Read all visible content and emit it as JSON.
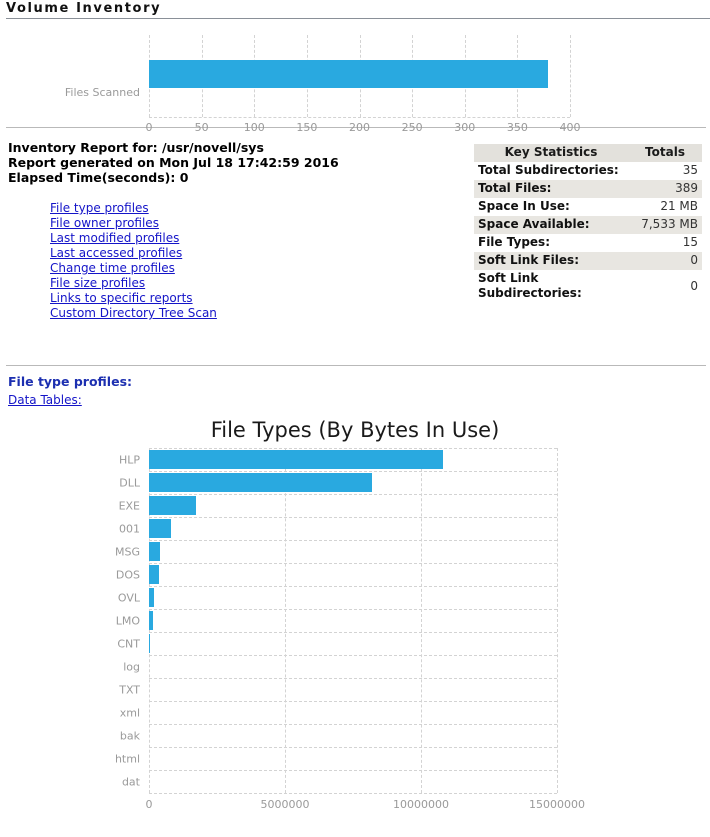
{
  "header": {
    "title": "Volume Inventory"
  },
  "top_chart": {
    "category_label": "Files Scanned",
    "ticks": [
      "0",
      "50",
      "100",
      "150",
      "200",
      "250",
      "300",
      "350",
      "400"
    ]
  },
  "report": {
    "line1": "Inventory Report for: /usr/novell/sys",
    "line2": "Report generated on Mon Jul 18 17:42:59 2016",
    "line3": "Elapsed Time(seconds): 0"
  },
  "links": [
    {
      "label": "File type profiles"
    },
    {
      "label": "File owner profiles"
    },
    {
      "label": "Last modified profiles"
    },
    {
      "label": "Last accessed profiles"
    },
    {
      "label": "Change time profiles"
    },
    {
      "label": "File size profiles"
    },
    {
      "label": "Links to specific reports"
    },
    {
      "label": "Custom Directory Tree Scan"
    }
  ],
  "stats": {
    "header_key": "Key Statistics",
    "header_value": "Totals",
    "rows": [
      {
        "key": "Total Subdirectories:",
        "value": "35"
      },
      {
        "key": "Total Files:",
        "value": "389"
      },
      {
        "key": "Space In Use:",
        "value": "21 MB"
      },
      {
        "key": "Space Available:",
        "value": "7,533 MB"
      },
      {
        "key": "File Types:",
        "value": "15"
      },
      {
        "key": "Soft Link Files:",
        "value": "0"
      },
      {
        "key": "Soft Link Subdirectories:",
        "value": "0"
      }
    ]
  },
  "file_type_section": {
    "heading": "File type profiles:",
    "data_tables_link": "Data Tables:"
  },
  "chart_data": [
    {
      "type": "bar",
      "orientation": "horizontal",
      "title": "",
      "categories": [
        "Files Scanned"
      ],
      "values": [
        379
      ],
      "xlabel": "",
      "ylabel": "",
      "xlim": [
        0,
        400
      ],
      "xticks": [
        0,
        50,
        100,
        150,
        200,
        250,
        300,
        350,
        400
      ],
      "grid": true,
      "legend": "none",
      "color": "#29a9e0"
    },
    {
      "type": "bar",
      "orientation": "horizontal",
      "title": "File Types (By Bytes In Use)",
      "categories": [
        "HLP",
        "DLL",
        "EXE",
        "001",
        "MSG",
        "DOS",
        "OVL",
        "LMO",
        "CNT",
        "log",
        "TXT",
        "xml",
        "bak",
        "html",
        "dat"
      ],
      "values": [
        10800000,
        8200000,
        1720000,
        810000,
        400000,
        360000,
        200000,
        165000,
        25000,
        0,
        0,
        0,
        0,
        0,
        0
      ],
      "xlabel": "",
      "ylabel": "",
      "xlim": [
        0,
        15000000
      ],
      "xticks": [
        0,
        5000000,
        10000000,
        15000000
      ],
      "xtick_labels": [
        "0",
        "5000000",
        "10000000",
        "15000000"
      ],
      "grid": true,
      "legend": "none",
      "color": "#29a9e0"
    }
  ]
}
